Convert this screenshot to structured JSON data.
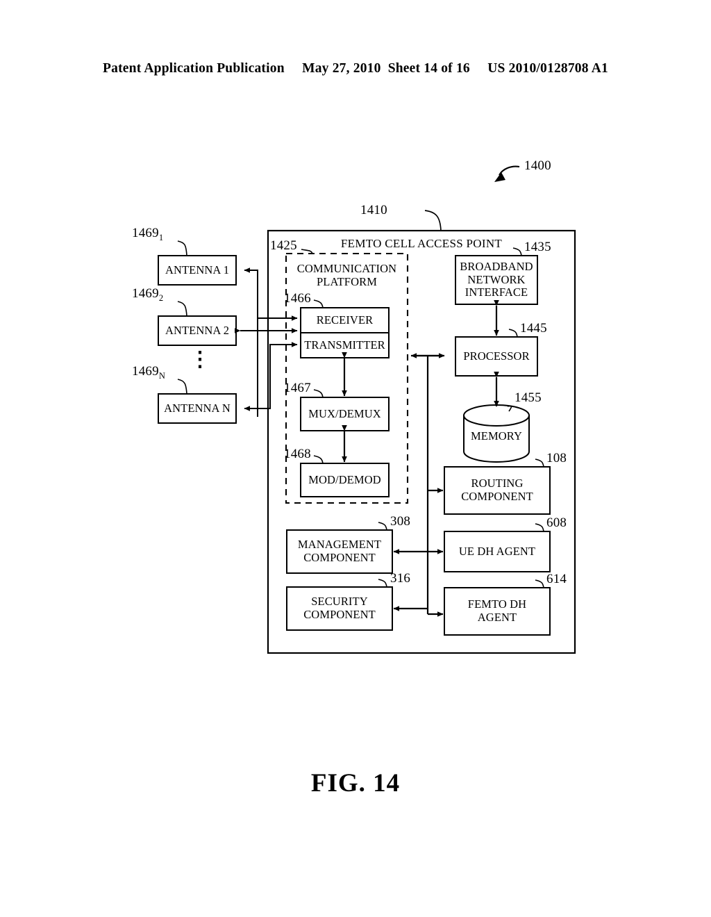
{
  "header": {
    "line": "Patent Application Publication     May 27, 2010  Sheet 14 of 16     US 2010/0128708 A1"
  },
  "figure": {
    "caption": "FIG. 14",
    "system_ref": "1400",
    "main_box_ref": "1410",
    "main_box_title": "FEMTO CELL ACCESS POINT"
  },
  "antennas": [
    {
      "label": "ANTENNA 1",
      "ref": "1469",
      "sub": "1"
    },
    {
      "label": "ANTENNA 2",
      "ref": "1469",
      "sub": "2"
    },
    {
      "label": "ANTENNA N",
      "ref": "1469",
      "sub": "N"
    }
  ],
  "ellipsis": "⋮",
  "platform": {
    "title": "COMMUNICATION\nPLATFORM",
    "ref": "1425",
    "blocks": [
      {
        "label": "RECEIVER",
        "ref": "1466"
      },
      {
        "label": "TRANSMITTER",
        "ref": ""
      },
      {
        "label": "MUX/DEMUX",
        "ref": "1467"
      },
      {
        "label": "MOD/DEMOD",
        "ref": "1468"
      }
    ]
  },
  "right_column": [
    {
      "label": "BROADBAND\nNETWORK\nINTERFACE",
      "ref": "1435"
    },
    {
      "label": "PROCESSOR",
      "ref": "1445"
    },
    {
      "label": "MEMORY",
      "ref": "1455"
    },
    {
      "label": "ROUTING\nCOMPONENT",
      "ref": "108"
    },
    {
      "label": "UE DH AGENT",
      "ref": "608"
    },
    {
      "label": "FEMTO DH\nAGENT",
      "ref": "614"
    }
  ],
  "left_column": [
    {
      "label": "MANAGEMENT\nCOMPONENT",
      "ref": "308"
    },
    {
      "label": "SECURITY\nCOMPONENT",
      "ref": "316"
    }
  ],
  "colors": {
    "ink": "#000000",
    "paper": "#ffffff"
  }
}
